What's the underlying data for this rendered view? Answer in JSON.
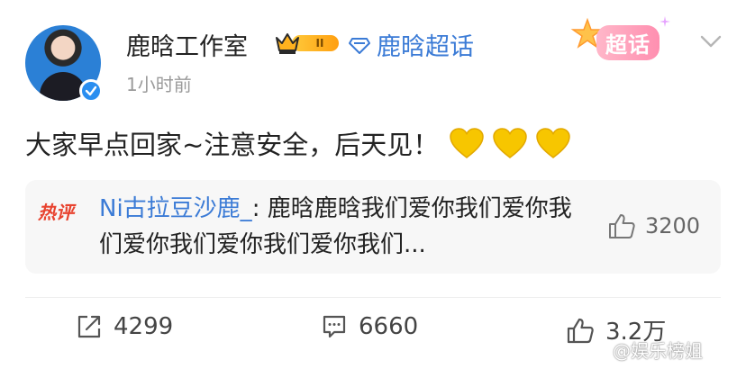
{
  "post": {
    "username": "鹿晗工作室",
    "level_badge": "II",
    "topic_label": "鹿晗超话",
    "chaohua_badge": "超话",
    "timestamp": "1小时前",
    "text": "大家早点回家~注意安全，后天见！",
    "heart_emojis": [
      "yellow-heart",
      "yellow-heart",
      "yellow-heart"
    ]
  },
  "hot_comment": {
    "label": "热评",
    "author": "Ni古拉豆沙鹿_",
    "separator": ": ",
    "text": "鹿晗鹿晗我们爱你我们爱你我们爱你我们爱你我们爱你我们...",
    "likes": "3200"
  },
  "actions": {
    "share_count": "4299",
    "comment_count": "6660",
    "like_count": "3.2万"
  },
  "watermark": "@娱乐榜姐",
  "colors": {
    "link_blue": "#3b7bd6",
    "hot_red": "#e8432f",
    "verified_blue": "#2a8ef0",
    "heart_yellow": "#f7c600",
    "badge_gold": "#ffb21e"
  }
}
